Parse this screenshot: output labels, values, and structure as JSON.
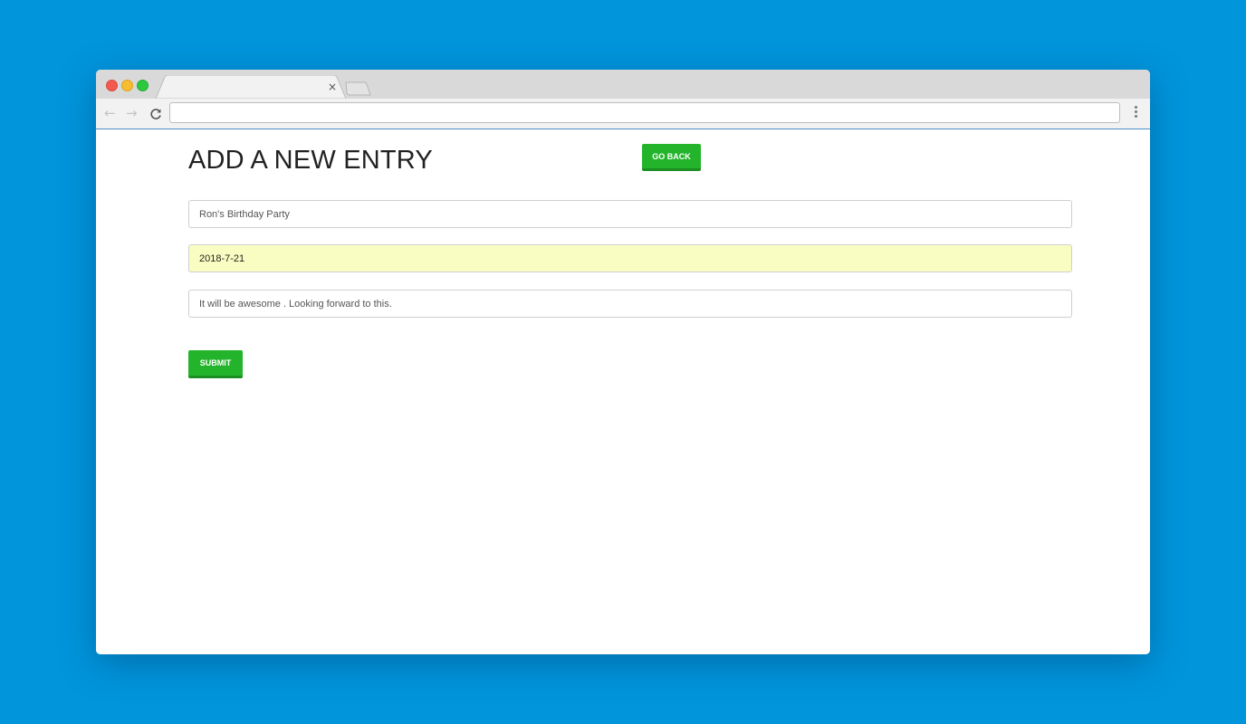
{
  "browser": {
    "tab": {
      "close_label": "×"
    },
    "nav": {
      "back": "←",
      "forward": "→",
      "reload": "C"
    }
  },
  "page": {
    "title": "ADD A NEW ENTRY",
    "go_back_label": "GO BACK",
    "submit_label": "SUBMIT",
    "form": {
      "title_value": "Ron's Birthday Party",
      "date_value": "2018-7-21",
      "description_value": "It will be awesome . Looking forward to this."
    }
  },
  "colors": {
    "background": "#0195dc",
    "button_green": "#24b42c",
    "autofill_yellow": "#fafdc1"
  }
}
